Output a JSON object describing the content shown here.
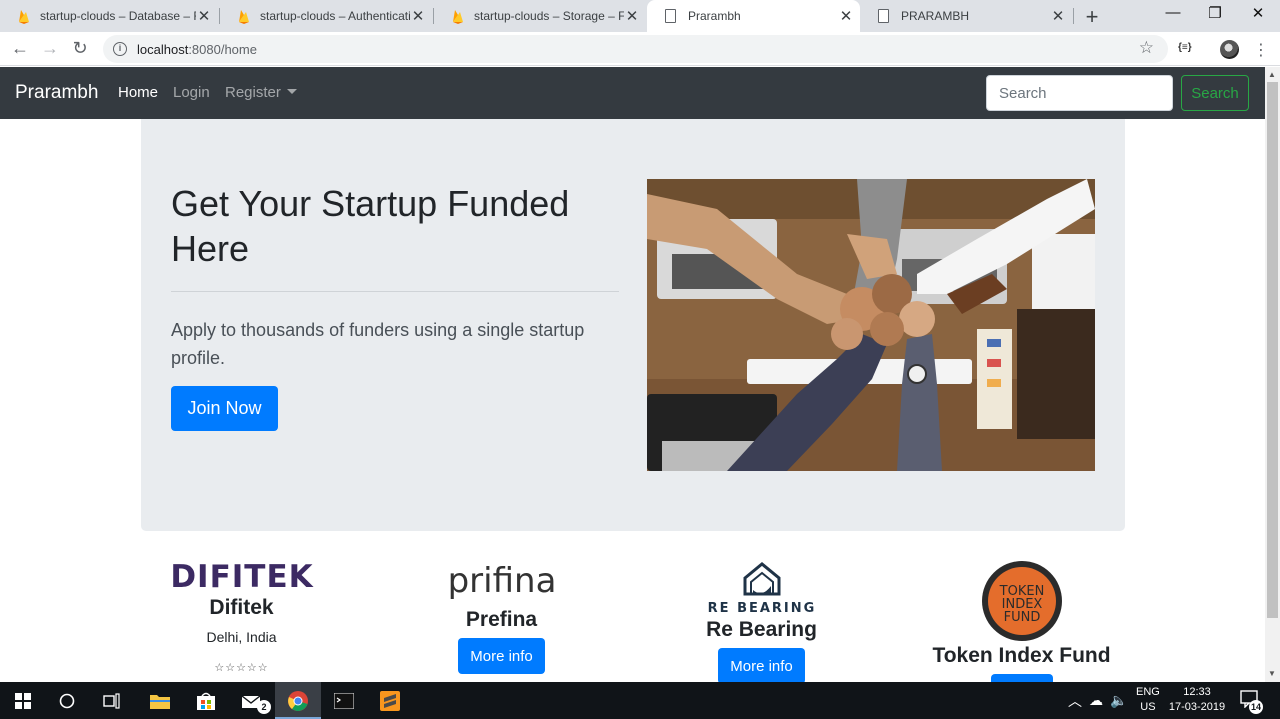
{
  "browser": {
    "tabs": [
      {
        "title": "startup-clouds – Database – Fi",
        "icon": "firebase-icon",
        "active": false
      },
      {
        "title": "startup-clouds – Authenticatio",
        "icon": "firebase-icon",
        "active": false
      },
      {
        "title": "startup-clouds – Storage – Fire",
        "icon": "firebase-icon",
        "active": false
      },
      {
        "title": "Prarambh",
        "icon": "document-icon",
        "active": true
      },
      {
        "title": "PRARAMBH",
        "icon": "document-icon",
        "active": false
      }
    ],
    "url_host": "localhost",
    "url_path": ":8080/home"
  },
  "navbar": {
    "brand": "Prarambh",
    "links": [
      "Home",
      "Login",
      "Register"
    ],
    "search_placeholder": "Search",
    "search_button": "Search"
  },
  "hero": {
    "title": "Get Your Startup Funded Here",
    "lead": "Apply to thousands of funders using a single startup profile.",
    "cta": "Join Now"
  },
  "cards": [
    {
      "logo_text": "DIFITEK",
      "name": "Difitek",
      "location": "Delhi, India",
      "stars": "☆☆☆☆☆"
    },
    {
      "logo_text": "prifina",
      "name": "Prefina",
      "button": "More info"
    },
    {
      "logo_text": "RE BEARING",
      "name": "Re Bearing",
      "button": "More info"
    },
    {
      "logo_text": "TOKEN INDEX FUND",
      "name": "Token Index Fund"
    }
  ],
  "taskbar": {
    "language": "ENG",
    "region": "US",
    "time": "12:33",
    "date": "17-03-2019",
    "notifications": "14",
    "mail_badge": "2"
  },
  "colors": {
    "navbar_bg": "#343a40",
    "primary": "#007bff",
    "success": "#28a745",
    "jumbotron_bg": "#e9ecef"
  }
}
